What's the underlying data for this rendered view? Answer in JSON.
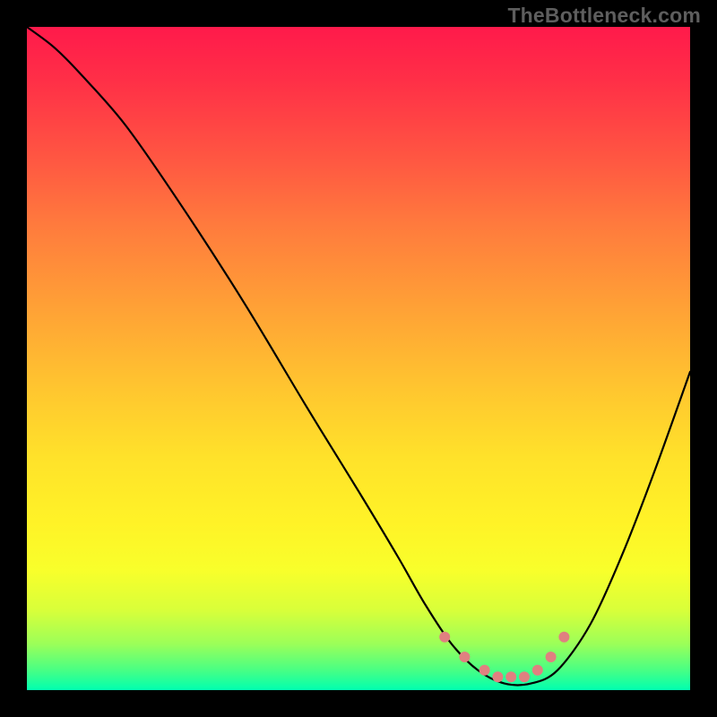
{
  "watermark": "TheBottleneck.com",
  "chart_data": {
    "type": "line",
    "title": "",
    "xlabel": "",
    "ylabel": "",
    "xlim": [
      0,
      100
    ],
    "ylim": [
      0,
      100
    ],
    "gradient_stops": [
      {
        "pos": 0,
        "color": "#ff1a4b"
      },
      {
        "pos": 8,
        "color": "#ff2f47"
      },
      {
        "pos": 20,
        "color": "#ff5742"
      },
      {
        "pos": 30,
        "color": "#ff7b3d"
      },
      {
        "pos": 42,
        "color": "#ffa036"
      },
      {
        "pos": 55,
        "color": "#ffc72f"
      },
      {
        "pos": 65,
        "color": "#ffe22a"
      },
      {
        "pos": 75,
        "color": "#fff327"
      },
      {
        "pos": 82,
        "color": "#f8ff2b"
      },
      {
        "pos": 88,
        "color": "#d8ff3a"
      },
      {
        "pos": 93,
        "color": "#9cff58"
      },
      {
        "pos": 97,
        "color": "#48ff84"
      },
      {
        "pos": 100,
        "color": "#00ffb0"
      }
    ],
    "series": [
      {
        "name": "bottleneck-curve",
        "x": [
          0,
          4,
          8,
          15,
          24,
          33,
          42,
          50,
          56,
          60,
          64,
          68,
          72,
          76,
          80,
          85,
          90,
          95,
          100
        ],
        "y": [
          100,
          97,
          93,
          85,
          72,
          58,
          43,
          30,
          20,
          13,
          7,
          3,
          1,
          1,
          3,
          10,
          21,
          34,
          48
        ]
      }
    ],
    "markers": {
      "name": "valley-markers",
      "color": "#e08080",
      "points": [
        {
          "x": 63,
          "y": 8
        },
        {
          "x": 66,
          "y": 5
        },
        {
          "x": 69,
          "y": 3
        },
        {
          "x": 71,
          "y": 2
        },
        {
          "x": 73,
          "y": 2
        },
        {
          "x": 75,
          "y": 2
        },
        {
          "x": 77,
          "y": 3
        },
        {
          "x": 79,
          "y": 5
        },
        {
          "x": 81,
          "y": 8
        }
      ]
    }
  }
}
